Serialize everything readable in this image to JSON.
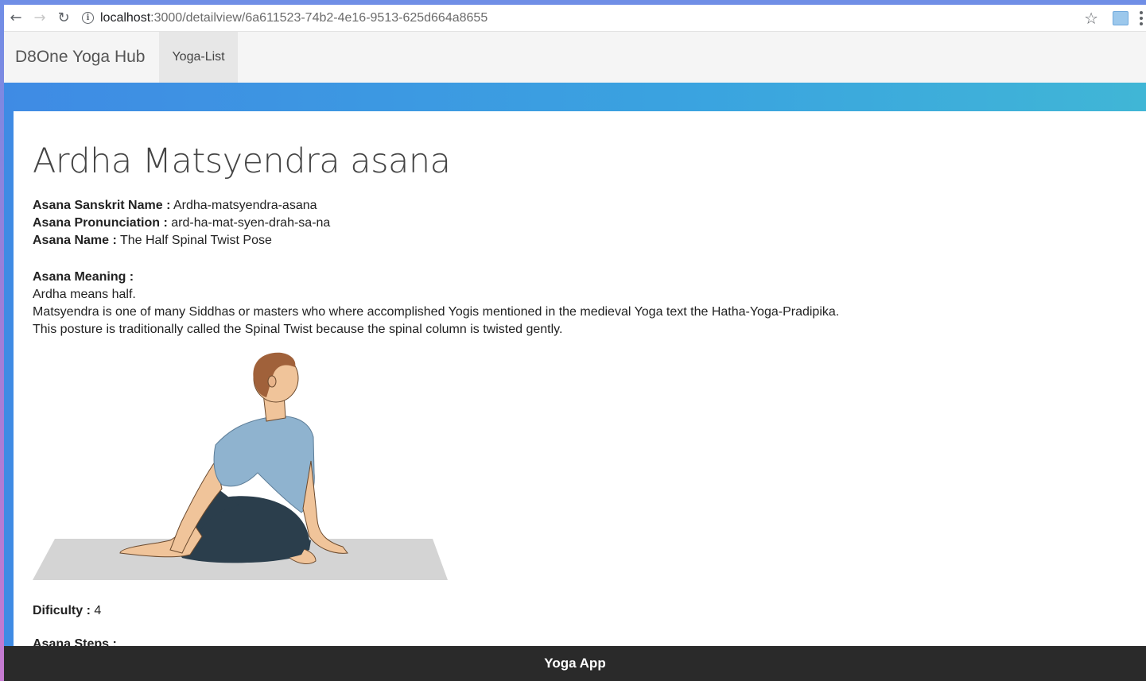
{
  "browser": {
    "url_host": "localhost",
    "url_rest": ":3000/detailview/6a611523-74b2-4e16-9513-625d664a8655"
  },
  "navbar": {
    "brand": "D8One Yoga Hub",
    "links": [
      {
        "label": "Yoga-List"
      }
    ]
  },
  "asana": {
    "title": "Ardha Matsyendra asana",
    "sanskrit_label": "Asana Sanskrit Name :",
    "sanskrit_value": " Ardha-matsyendra-asana",
    "pronunciation_label": "Asana Pronunciation :",
    "pronunciation_value": " ard-ha-mat-syen-drah-sa-na",
    "name_label": "Asana Name :",
    "name_value": " The Half Spinal Twist Pose",
    "meaning_label": "Asana Meaning :",
    "meaning_lines": [
      "Ardha means half.",
      "Matsyendra is one of many Siddhas or masters who where accomplished Yogis mentioned in the medieval Yoga text the Hatha-Yoga-Pradipika.",
      "This posture is traditionally called the Spinal Twist because the spinal column is twisted gently."
    ],
    "difficulty_label": "Dificulty :",
    "difficulty_value": " 4",
    "steps_label": "Asana Steps :"
  },
  "footer": {
    "label": "Yoga App"
  },
  "colors": {
    "banner": "#3aa3e0",
    "footer": "#2a2a2a",
    "shirt": "#8fb3cf",
    "pants": "#2b3e4c",
    "mat": "#d4d4d4"
  }
}
